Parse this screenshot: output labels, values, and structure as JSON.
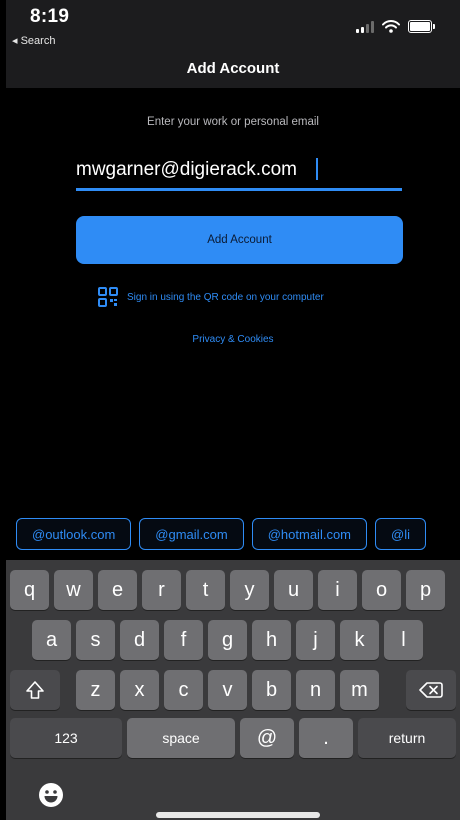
{
  "status": {
    "time": "8:19",
    "back_label": "◂ Search"
  },
  "nav": {
    "title": "Add Account"
  },
  "form": {
    "prompt": "Enter your work or personal email",
    "email_value": "mwgarner@digierack.com",
    "submit_label": "Add Account",
    "qr_label": "Sign in using the QR code on your computer",
    "privacy_label": "Privacy & Cookies"
  },
  "domains": [
    "@outlook.com",
    "@gmail.com",
    "@hotmail.com",
    "@li"
  ],
  "keyboard": {
    "row1": [
      "q",
      "w",
      "e",
      "r",
      "t",
      "y",
      "u",
      "i",
      "o",
      "p"
    ],
    "row2": [
      "a",
      "s",
      "d",
      "f",
      "g",
      "h",
      "j",
      "k",
      "l"
    ],
    "row3": [
      "z",
      "x",
      "c",
      "v",
      "b",
      "n",
      "m"
    ],
    "numbers_label": "123",
    "space_label": "space",
    "at_label": "@",
    "dot_label": ".",
    "return_label": "return"
  },
  "colors": {
    "accent": "#2f8cf5",
    "key": "#6f6f72",
    "keyboard_bg": "#3a3a3c",
    "nav_bg": "#1c1c1e"
  }
}
